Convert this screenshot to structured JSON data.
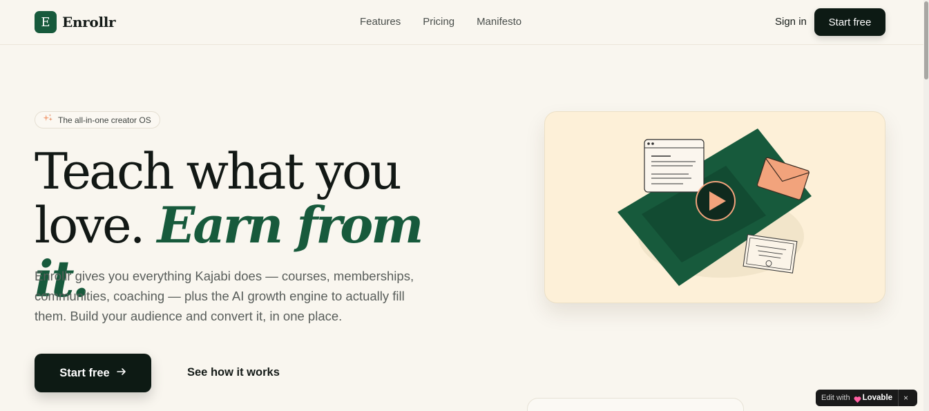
{
  "brand": {
    "logo_letter": "E",
    "name": "Enrollr"
  },
  "nav": {
    "items": [
      "Features",
      "Pricing",
      "Manifesto"
    ]
  },
  "header": {
    "signin_label": "Sign in",
    "start_label": "Start free"
  },
  "hero": {
    "badge_text": "The all-in-one creator OS",
    "headline_line1": "Teach what you",
    "headline_line2_plain": "love.",
    "headline_line2_accent": "Earn from it.",
    "subtext": "Enrollr gives you everything Kajabi does — courses, memberships, communities, coaching — plus the AI growth engine to actually fill them. Build your audience and convert it, in one place.",
    "cta_primary": "Start free",
    "cta_secondary": "See how it works"
  },
  "lovable": {
    "edit_text": "Edit with",
    "brand_text": "Lovable",
    "close_icon": "×"
  },
  "colors": {
    "background": "#f9f6ef",
    "brand_green": "#175a3c",
    "dark_button": "#0d1a14",
    "illustration_bg": "#fdf0d8",
    "envelope": "#f2a37c"
  },
  "icons": [
    "sparkle-icon",
    "arrow-right-icon",
    "play-icon",
    "envelope-icon",
    "certificate-icon",
    "heart-icon",
    "close-icon"
  ]
}
